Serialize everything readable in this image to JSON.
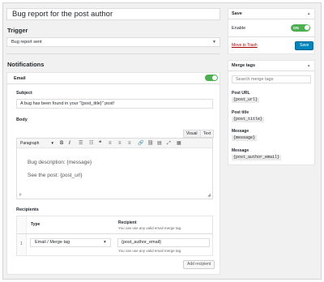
{
  "post_title": "Bug report for the post author",
  "trigger": {
    "heading": "Trigger",
    "selected": "Bug report sent"
  },
  "notifications": {
    "heading": "Notifications",
    "email": {
      "label": "Email",
      "subject_label": "Subject",
      "subject_value": "A bug has been found in your \"{post_title}\" post!",
      "body_label": "Body",
      "tab_visual": "Visual",
      "tab_text": "Text",
      "toolbar_format": "Paragraph",
      "body_line1": "Bug description: {message}",
      "body_line2": "See the post: {post_url}",
      "status_path": "p",
      "recipients_label": "Recipients",
      "recipients_table": {
        "col_type": "Type",
        "col_recipient": "Recipient",
        "col_recipient_help": "You can use any valid email merge tag.",
        "rows": [
          {
            "index": "1",
            "type": "Email / Merge tag",
            "recipient": "{post_author_email}",
            "help": "You can use any valid email merge tag."
          }
        ]
      },
      "add_recipient": "Add recipient"
    }
  },
  "save_box": {
    "title": "Save",
    "enable_label": "Enable",
    "toggle_label": "ON",
    "trash_link": "Move to Trash",
    "save_button": "Save"
  },
  "merge_tags": {
    "title": "Merge tags",
    "search_placeholder": "Search merge tags",
    "tags": [
      {
        "label": "Post URL",
        "code": "{post_url}"
      },
      {
        "label": "Post title",
        "code": "{post_title}"
      },
      {
        "label": "Message",
        "code": "{message}"
      },
      {
        "label": "Message",
        "code": "{post_author_email}"
      }
    ]
  },
  "colors": {
    "accent": "#0085ba",
    "toggle_on": "#4caf50",
    "trash": "#a00"
  }
}
